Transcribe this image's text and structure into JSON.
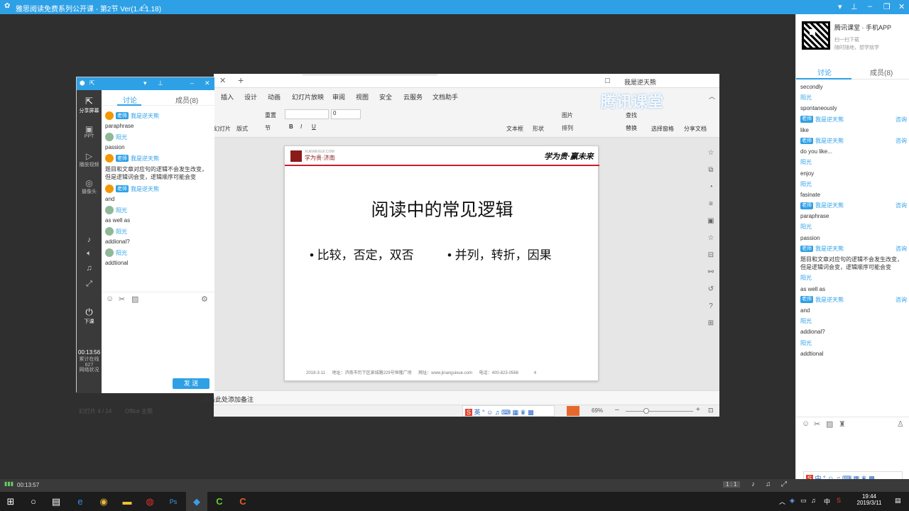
{
  "window": {
    "title": "雅思阅读免费系列公开课 - 第2节 Ver(1.4.1.18)"
  },
  "right_panel": {
    "app_name": "腾讯课堂 · 手机APP",
    "scan_hint": "扫一扫下载",
    "scan_sub": "随时随地，想学就学",
    "tabs": [
      "讨论",
      "成员(8)"
    ],
    "messages": [
      {
        "name": "",
        "badge": "",
        "body": "secondly",
        "reply": ""
      },
      {
        "name": "阳光",
        "badge": "",
        "body": "spontaneously",
        "reply": ""
      },
      {
        "name": "我是逆天熊",
        "badge": "老师",
        "body": "like",
        "reply": "咨询"
      },
      {
        "name": "我是逆天熊",
        "badge": "老师",
        "body": "do you like...",
        "reply": "咨询"
      },
      {
        "name": "阳光",
        "badge": "",
        "body": "enjoy",
        "reply": ""
      },
      {
        "name": "阳光",
        "badge": "",
        "body": "fasinate",
        "reply": ""
      },
      {
        "name": "我是逆天熊",
        "badge": "老师",
        "body": "paraphrase",
        "reply": "咨询"
      },
      {
        "name": "阳光",
        "badge": "",
        "body": "passion",
        "reply": ""
      },
      {
        "name": "我是逆天熊",
        "badge": "老师",
        "body": "题目和文章对应句的逻辑不会发生改变，但是逻辑词会变，逻辑顺序可能会变",
        "reply": "咨询"
      },
      {
        "name": "阳光",
        "badge": "",
        "body": "as well as",
        "reply": ""
      },
      {
        "name": "我是逆天熊",
        "badge": "老师",
        "body": "and",
        "reply": "咨询"
      },
      {
        "name": "阳光",
        "badge": "",
        "body": "addional?",
        "reply": ""
      },
      {
        "name": "阳光",
        "badge": "",
        "body": "addtional",
        "reply": ""
      }
    ]
  },
  "chat": {
    "tabs": [
      "讨论",
      "成员(8)"
    ],
    "side": [
      "分享屏幕",
      "PPT",
      "播放视频",
      "摄像头",
      "下课"
    ],
    "timer": "00:13:56",
    "stats": [
      "累计在线",
      "627",
      "网络状况"
    ],
    "messages": [
      {
        "name": "我是逆天熊",
        "badge": "老师",
        "teacher": true,
        "body": "paraphrase"
      },
      {
        "name": "阳光",
        "badge": "",
        "teacher": false,
        "body": "passion"
      },
      {
        "name": "我是逆天熊",
        "badge": "老师",
        "teacher": true,
        "body": "题目和文章对应句的逻辑不会发生改变，但是逻辑词会变，逻辑顺序可能会变"
      },
      {
        "name": "我是逆天熊",
        "badge": "老师",
        "teacher": true,
        "body": "and"
      },
      {
        "name": "阳光",
        "badge": "",
        "teacher": false,
        "body": "as well as"
      },
      {
        "name": "阳光",
        "badge": "",
        "teacher": false,
        "body": "addional?"
      },
      {
        "name": "阳光",
        "badge": "",
        "teacher": false,
        "body": "addtional"
      }
    ],
    "send": "发 送"
  },
  "ppt": {
    "user": "我是逆天熊",
    "tabs": [
      "插入",
      "设计",
      "动画",
      "幻灯片放映",
      "审阅",
      "视图",
      "安全",
      "云服务",
      "文档助手"
    ],
    "watermark": "腾讯课堂",
    "ribbon": [
      "重置",
      "节",
      "文本框",
      "形状",
      "图片",
      "排列",
      "查找",
      "替换",
      "选择窗格",
      "分享文档",
      "幻灯片",
      "版式"
    ],
    "font_size": "0",
    "slide": {
      "logo_text": "学为贵·济南",
      "logo_sub": "XUEWEIGUI.COM",
      "slogan": "学为贵·赢未来",
      "title": "阅读中的常见逻辑",
      "bullet1": "• 比较，否定，双否",
      "bullet2": "• 并列，转折，因果",
      "footer_date": "2019-3-11",
      "footer_addr": "地址：济南市历下区泉城路229号恒隆广场",
      "footer_web": "网址：www.jinanguixue.com",
      "footer_tel": "电话：400-823-0566",
      "footer_page": "4"
    },
    "notes": "单击此处添加备注",
    "status_slide": "幻灯片 4 / 14",
    "status_theme": "Office 主题",
    "zoom": "69%"
  },
  "player": {
    "time": "00:13:57",
    "ratio": "1 : 1"
  },
  "taskbar": {
    "time": "19:44",
    "date": "2019/3/11",
    "ime": "中"
  }
}
